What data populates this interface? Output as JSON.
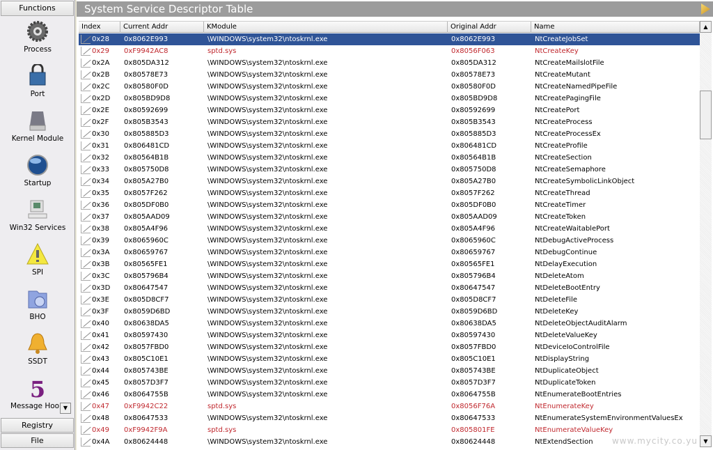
{
  "sidebar": {
    "header": "Functions",
    "items": [
      {
        "label": "Process",
        "icon": "gear-icon"
      },
      {
        "label": "Port",
        "icon": "lock-icon"
      },
      {
        "label": "Kernel Module",
        "icon": "drive-icon"
      },
      {
        "label": "Startup",
        "icon": "globe-icon"
      },
      {
        "label": "Win32 Services",
        "icon": "computer-icon"
      },
      {
        "label": "SPI",
        "icon": "warning-icon"
      },
      {
        "label": "BHO",
        "icon": "folder-icon"
      },
      {
        "label": "SSDT",
        "icon": "bell-icon"
      },
      {
        "label": "Message Hook",
        "icon": "hook-icon"
      }
    ],
    "registry": "Registry",
    "file": "File"
  },
  "main": {
    "title": "System Service Descriptor Table",
    "columns": [
      "Index",
      "Current Addr",
      "KModule",
      "Original Addr",
      "Name"
    ],
    "hook_color": "#c0282e",
    "selected_color": "#2f5497",
    "rows": [
      [
        "0x28",
        "0x8062E993",
        "\\WINDOWS\\system32\\ntoskrnl.exe",
        "0x8062E993",
        "NtCreateJobSet",
        "selected"
      ],
      [
        "0x29",
        "0xF9942AC8",
        "sptd.sys",
        "0x8056F063",
        "NtCreateKey",
        "hooked"
      ],
      [
        "0x2A",
        "0x805DA312",
        "\\WINDOWS\\system32\\ntoskrnl.exe",
        "0x805DA312",
        "NtCreateMailslotFile",
        ""
      ],
      [
        "0x2B",
        "0x80578E73",
        "\\WINDOWS\\system32\\ntoskrnl.exe",
        "0x80578E73",
        "NtCreateMutant",
        ""
      ],
      [
        "0x2C",
        "0x80580F0D",
        "\\WINDOWS\\system32\\ntoskrnl.exe",
        "0x80580F0D",
        "NtCreateNamedPipeFile",
        ""
      ],
      [
        "0x2D",
        "0x805BD9D8",
        "\\WINDOWS\\system32\\ntoskrnl.exe",
        "0x805BD9D8",
        "NtCreatePagingFile",
        ""
      ],
      [
        "0x2E",
        "0x80592699",
        "\\WINDOWS\\system32\\ntoskrnl.exe",
        "0x80592699",
        "NtCreatePort",
        ""
      ],
      [
        "0x2F",
        "0x805B3543",
        "\\WINDOWS\\system32\\ntoskrnl.exe",
        "0x805B3543",
        "NtCreateProcess",
        ""
      ],
      [
        "0x30",
        "0x805885D3",
        "\\WINDOWS\\system32\\ntoskrnl.exe",
        "0x805885D3",
        "NtCreateProcessEx",
        ""
      ],
      [
        "0x31",
        "0x806481CD",
        "\\WINDOWS\\system32\\ntoskrnl.exe",
        "0x806481CD",
        "NtCreateProfile",
        ""
      ],
      [
        "0x32",
        "0x80564B1B",
        "\\WINDOWS\\system32\\ntoskrnl.exe",
        "0x80564B1B",
        "NtCreateSection",
        ""
      ],
      [
        "0x33",
        "0x805750D8",
        "\\WINDOWS\\system32\\ntoskrnl.exe",
        "0x805750D8",
        "NtCreateSemaphore",
        ""
      ],
      [
        "0x34",
        "0x805A27B0",
        "\\WINDOWS\\system32\\ntoskrnl.exe",
        "0x805A27B0",
        "NtCreateSymbolicLinkObject",
        ""
      ],
      [
        "0x35",
        "0x8057F262",
        "\\WINDOWS\\system32\\ntoskrnl.exe",
        "0x8057F262",
        "NtCreateThread",
        ""
      ],
      [
        "0x36",
        "0x805DF0B0",
        "\\WINDOWS\\system32\\ntoskrnl.exe",
        "0x805DF0B0",
        "NtCreateTimer",
        ""
      ],
      [
        "0x37",
        "0x805AAD09",
        "\\WINDOWS\\system32\\ntoskrnl.exe",
        "0x805AAD09",
        "NtCreateToken",
        ""
      ],
      [
        "0x38",
        "0x805A4F96",
        "\\WINDOWS\\system32\\ntoskrnl.exe",
        "0x805A4F96",
        "NtCreateWaitablePort",
        ""
      ],
      [
        "0x39",
        "0x8065960C",
        "\\WINDOWS\\system32\\ntoskrnl.exe",
        "0x8065960C",
        "NtDebugActiveProcess",
        ""
      ],
      [
        "0x3A",
        "0x80659767",
        "\\WINDOWS\\system32\\ntoskrnl.exe",
        "0x80659767",
        "NtDebugContinue",
        ""
      ],
      [
        "0x3B",
        "0x80565FE1",
        "\\WINDOWS\\system32\\ntoskrnl.exe",
        "0x80565FE1",
        "NtDelayExecution",
        ""
      ],
      [
        "0x3C",
        "0x805796B4",
        "\\WINDOWS\\system32\\ntoskrnl.exe",
        "0x805796B4",
        "NtDeleteAtom",
        ""
      ],
      [
        "0x3D",
        "0x80647547",
        "\\WINDOWS\\system32\\ntoskrnl.exe",
        "0x80647547",
        "NtDeleteBootEntry",
        ""
      ],
      [
        "0x3E",
        "0x805D8CF7",
        "\\WINDOWS\\system32\\ntoskrnl.exe",
        "0x805D8CF7",
        "NtDeleteFile",
        ""
      ],
      [
        "0x3F",
        "0x8059D6BD",
        "\\WINDOWS\\system32\\ntoskrnl.exe",
        "0x8059D6BD",
        "NtDeleteKey",
        ""
      ],
      [
        "0x40",
        "0x80638DA5",
        "\\WINDOWS\\system32\\ntoskrnl.exe",
        "0x80638DA5",
        "NtDeleteObjectAuditAlarm",
        ""
      ],
      [
        "0x41",
        "0x80597430",
        "\\WINDOWS\\system32\\ntoskrnl.exe",
        "0x80597430",
        "NtDeleteValueKey",
        ""
      ],
      [
        "0x42",
        "0x8057FBD0",
        "\\WINDOWS\\system32\\ntoskrnl.exe",
        "0x8057FBD0",
        "NtDeviceIoControlFile",
        ""
      ],
      [
        "0x43",
        "0x805C10E1",
        "\\WINDOWS\\system32\\ntoskrnl.exe",
        "0x805C10E1",
        "NtDisplayString",
        ""
      ],
      [
        "0x44",
        "0x805743BE",
        "\\WINDOWS\\system32\\ntoskrnl.exe",
        "0x805743BE",
        "NtDuplicateObject",
        ""
      ],
      [
        "0x45",
        "0x8057D3F7",
        "\\WINDOWS\\system32\\ntoskrnl.exe",
        "0x8057D3F7",
        "NtDuplicateToken",
        ""
      ],
      [
        "0x46",
        "0x8064755B",
        "\\WINDOWS\\system32\\ntoskrnl.exe",
        "0x8064755B",
        "NtEnumerateBootEntries",
        ""
      ],
      [
        "0x47",
        "0xF9942C22",
        "sptd.sys",
        "0x8056F76A",
        "NtEnumerateKey",
        "hooked"
      ],
      [
        "0x48",
        "0x80647533",
        "\\WINDOWS\\system32\\ntoskrnl.exe",
        "0x80647533",
        "NtEnumerateSystemEnvironmentValuesEx",
        ""
      ],
      [
        "0x49",
        "0xF9942F9A",
        "sptd.sys",
        "0x805801FE",
        "NtEnumerateValueKey",
        "hooked"
      ],
      [
        "0x4A",
        "0x80624448",
        "\\WINDOWS\\system32\\ntoskrnl.exe",
        "0x80624448",
        "NtExtendSection",
        ""
      ]
    ]
  },
  "watermark": "www.mycity.co.yu"
}
